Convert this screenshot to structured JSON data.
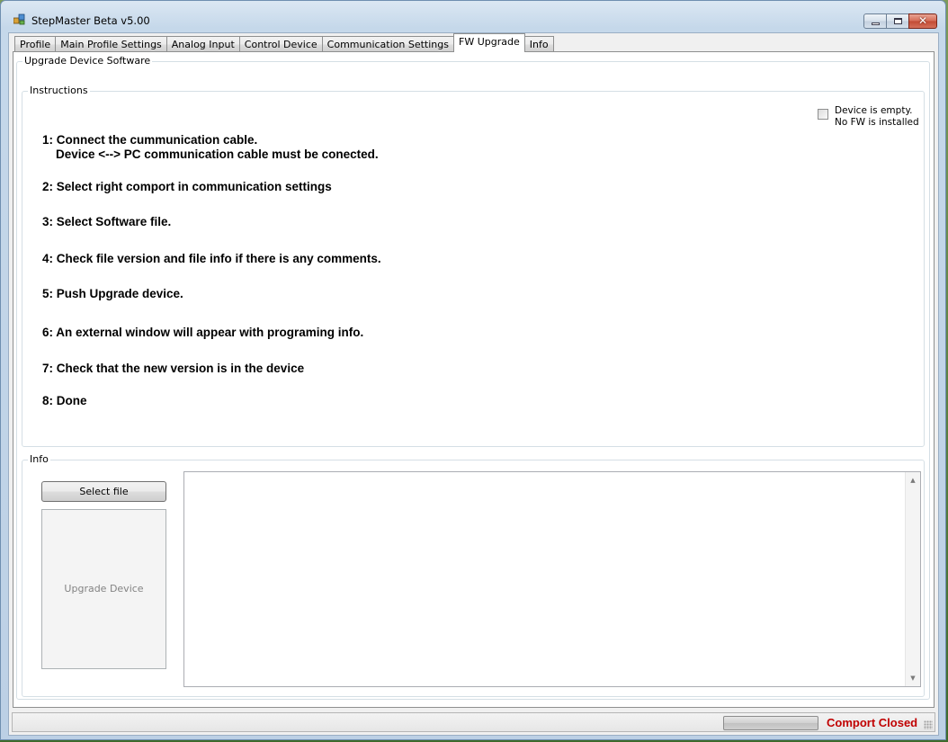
{
  "window": {
    "title": "StepMaster Beta v5.00"
  },
  "tabs": [
    {
      "label": "Profile",
      "active": false
    },
    {
      "label": "Main Profile Settings",
      "active": false
    },
    {
      "label": "Analog Input",
      "active": false
    },
    {
      "label": "Control Device",
      "active": false
    },
    {
      "label": "Communication Settings",
      "active": false
    },
    {
      "label": "FW Upgrade",
      "active": true
    },
    {
      "label": "Info",
      "active": false
    }
  ],
  "upgrade": {
    "group_title": "Upgrade Device Software",
    "instructions": {
      "title": "Instructions",
      "checkbox": {
        "line1": "Device is empty.",
        "line2": "No FW is installed",
        "checked": false
      },
      "steps": [
        "1: Connect the cummunication cable.\n    Device <--> PC communication cable must be conected.",
        "2: Select right comport in communication settings",
        "3: Select Software file.",
        "4: Check file version and file info if there is any comments.",
        "5: Push Upgrade device.",
        "6: An external window will appear with programing info.",
        "7: Check that the new version is in the device",
        "8: Done"
      ]
    },
    "info": {
      "title": "Info",
      "select_button": "Select file",
      "upgrade_button": "Upgrade Device",
      "log_text": ""
    }
  },
  "status": {
    "progress": 0,
    "comport_text": "Comport Closed",
    "comport_color": "#c00000"
  },
  "icons": {
    "app": "app-window-icon",
    "minimize": "minimize-icon",
    "maximize": "maximize-icon",
    "close": "close-icon"
  }
}
